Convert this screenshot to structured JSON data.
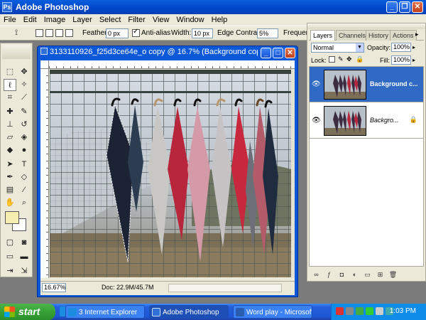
{
  "app": {
    "title": "Adobe Photoshop"
  },
  "menu": [
    "File",
    "Edit",
    "Image",
    "Layer",
    "Select",
    "Filter",
    "View",
    "Window",
    "Help"
  ],
  "options": {
    "feather_label": "Feather:",
    "feather_value": "0 px",
    "antialias_label": "Anti-alias",
    "width_label": "Width:",
    "width_value": "10 px",
    "edge_contrast_label": "Edge Contrast:",
    "edge_contrast_value": "5%",
    "frequency_label": "Frequency"
  },
  "document": {
    "title": "3133110926_f25d3ce64e_o copy @ 16.7% (Background cop...",
    "zoom": "16.67%",
    "doc_size": "Doc: 22.9M/45.7M"
  },
  "layers_panel": {
    "tabs": [
      "Layers",
      "Channels",
      "History",
      "Actions"
    ],
    "blend_mode": "Normal",
    "opacity_label": "Opacity:",
    "opacity_value": "100%",
    "lock_label": "Lock:",
    "fill_label": "Fill:",
    "fill_value": "100%",
    "layers": [
      {
        "name": "Background c...",
        "selected": true,
        "locked": false
      },
      {
        "name": "Backgro...",
        "selected": false,
        "locked": true
      }
    ]
  },
  "taskbar": {
    "start_label": "start",
    "items": [
      {
        "label": "3 Internet Explorer",
        "active": false
      },
      {
        "label": "Adobe Photoshop",
        "active": true
      },
      {
        "label": "Word play - Microsoft...",
        "active": false
      }
    ],
    "clock": "1:03 PM"
  },
  "colors": {
    "title_bar": "#0046c8",
    "foreground_swatch": "#f5eeb0",
    "background_swatch": "#ffffff",
    "selected_layer": "#316ac5"
  }
}
